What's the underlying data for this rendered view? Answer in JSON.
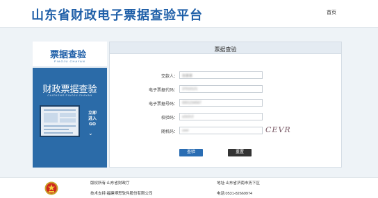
{
  "header": {
    "site_title": "山东省财政电子票据查验平台",
    "home_label": "首页"
  },
  "banner": {
    "logo_cn": "票据查验",
    "logo_en": "PIAOJU CHAYAN",
    "title_cn": "财政票据查验",
    "title_en": "CAIZHENG PIAOJU CHAYAN",
    "enter_line1": "立即",
    "enter_line2": "进入",
    "enter_line3": "GO"
  },
  "panel": {
    "title": "票据查验",
    "fields": {
      "payer": {
        "label": "交款人：",
        "value": "张某某"
      },
      "bill_code": {
        "label": "电子票据代码：",
        "value": "37010121"
      },
      "bill_number": {
        "label": "电子票据号码：",
        "value": "0001234567"
      },
      "check_code": {
        "label": "校验码：",
        "value": "a1b2c3"
      },
      "captcha": {
        "label": "随机码：",
        "value": "ceer",
        "image_text": "CEVR"
      }
    },
    "query_label": "查验",
    "reset_label": "重置"
  },
  "footer": {
    "owner": "版权所有:山东省财政厅",
    "address": "地址:山东省济南市历下区",
    "support": "技术支持:福建博思软件股份有限公司",
    "phone": "电话:0531-82669974"
  },
  "colors": {
    "brand_blue": "#1f5fa8",
    "banner_blue": "#2b6ba8",
    "query_button": "#2a6db3",
    "reset_button": "#333333"
  }
}
